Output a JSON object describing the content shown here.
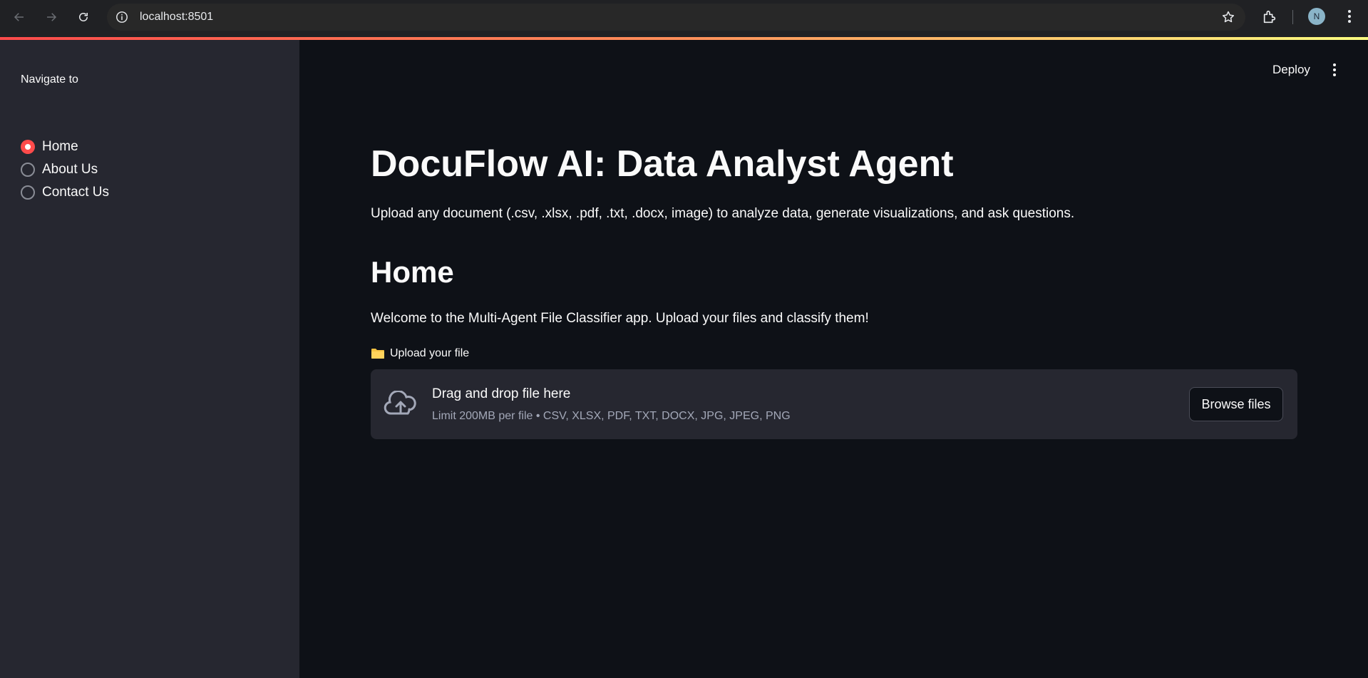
{
  "browser": {
    "url": "localhost:8501",
    "avatar_initial": "N"
  },
  "sidebar": {
    "nav_label": "Navigate to",
    "items": [
      {
        "label": "Home",
        "selected": true
      },
      {
        "label": "About Us",
        "selected": false
      },
      {
        "label": "Contact Us",
        "selected": false
      }
    ]
  },
  "toolbar": {
    "deploy_label": "Deploy"
  },
  "main": {
    "title": "DocuFlow AI: Data Analyst Agent",
    "subtitle": "Upload any document (.csv, .xlsx, .pdf, .txt, .docx, image) to analyze data, generate visualizations, and ask questions.",
    "section_heading": "Home",
    "welcome_text": "Welcome to the Multi-Agent File Classifier app. Upload your files and classify them!",
    "uploader": {
      "label": "Upload your file",
      "drop_title": "Drag and drop file here",
      "drop_hint": "Limit 200MB per file • CSV, XLSX, PDF, TXT, DOCX, JPG, JPEG, PNG",
      "browse_label": "Browse files"
    }
  },
  "colors": {
    "accent": "#ff4b4b",
    "background": "#0e1117",
    "sidebar": "#262730"
  }
}
